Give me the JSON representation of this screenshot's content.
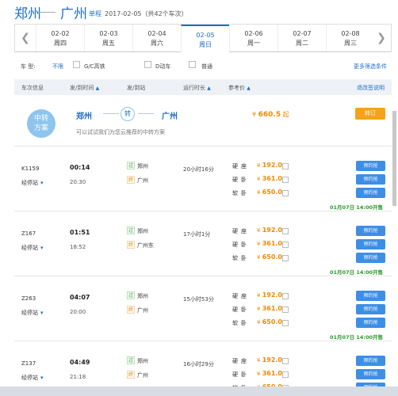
{
  "header": {
    "from": "郑州",
    "to": "广州",
    "trip_type": "单程",
    "summary": "2017-02-05（共42个车次）"
  },
  "dates": [
    {
      "date": "02-02",
      "week": "周四"
    },
    {
      "date": "02-03",
      "week": "周五"
    },
    {
      "date": "02-04",
      "week": "周六"
    },
    {
      "date": "02-05",
      "week": "周日",
      "active": true
    },
    {
      "date": "02-06",
      "week": "周一"
    },
    {
      "date": "02-07",
      "week": "周二"
    },
    {
      "date": "02-08",
      "week": "周三"
    }
  ],
  "filter": {
    "label": "车  型:",
    "all": "不限",
    "opt1": "G/C高铁",
    "opt2": "D动车",
    "opt3": "普通",
    "more": "更多筛选条件"
  },
  "columns": {
    "train": "车次信息",
    "time": "发/到时间",
    "station": "发/到站",
    "duration": "运行时长",
    "price": "参考价",
    "refund": "退改签说明"
  },
  "transfer": {
    "icon_text_1": "中转",
    "icon_text_2": "方案",
    "from": "郑州",
    "zhuan": "转",
    "to": "广州",
    "price_prefix": "¥",
    "price": "660.5",
    "price_suffix": "起",
    "button": "转订",
    "note": "可以试试我们为您云推荐的中转方案"
  },
  "trains": [
    {
      "no": "K1159",
      "via": "经停站",
      "dep_time": "00:14",
      "arr_time": "20:30",
      "dep_tag": "过",
      "from": "郑州",
      "arr_tag": "终",
      "to": "广州",
      "duration": "20小时16分",
      "seats": [
        {
          "cls": "硬座",
          "price": "192.0"
        },
        {
          "cls": "硬卧",
          "price": "361.0"
        },
        {
          "cls": "软卧",
          "price": "650.0"
        }
      ],
      "button": "预约抢",
      "sale": "01月07日 14:00开售"
    },
    {
      "no": "Z167",
      "via": "经停站",
      "dep_time": "01:51",
      "arr_time": "18:52",
      "dep_tag": "过",
      "from": "郑州",
      "arr_tag": "终",
      "to": "广州东",
      "duration": "17小时1分",
      "seats": [
        {
          "cls": "硬座",
          "price": "192.0"
        },
        {
          "cls": "硬卧",
          "price": "361.0"
        },
        {
          "cls": "软卧",
          "price": "650.0"
        }
      ],
      "button": "预约抢",
      "sale": "01月07日 14:00开售"
    },
    {
      "no": "Z263",
      "via": "经停站",
      "dep_time": "04:07",
      "arr_time": "20:00",
      "dep_tag": "过",
      "from": "郑州",
      "arr_tag": "终",
      "to": "广州",
      "duration": "15小时53分",
      "seats": [
        {
          "cls": "硬座",
          "price": "192.0"
        },
        {
          "cls": "硬卧",
          "price": "361.0"
        },
        {
          "cls": "软卧",
          "price": "650.0"
        }
      ],
      "button": "预约抢",
      "sale": "01月07日 14:00开售"
    },
    {
      "no": "Z137",
      "via": "经停站",
      "dep_time": "04:49",
      "arr_time": "21:18",
      "dep_tag": "过",
      "from": "郑州",
      "arr_tag": "终",
      "to": "广州",
      "duration": "16小时29分",
      "seats": [
        {
          "cls": "硬座",
          "price": "192.0"
        },
        {
          "cls": "硬卧",
          "price": "361.0"
        },
        {
          "cls": "软卧",
          "price": "650.0"
        }
      ],
      "button": "预约抢",
      "sale": ""
    }
  ],
  "colors": {
    "accent": "#1e6ec8",
    "price": "#f08a00",
    "book_button": "#3d8ee5",
    "transfer_button": "#f7a21b",
    "sale": "#2a9a2a"
  }
}
